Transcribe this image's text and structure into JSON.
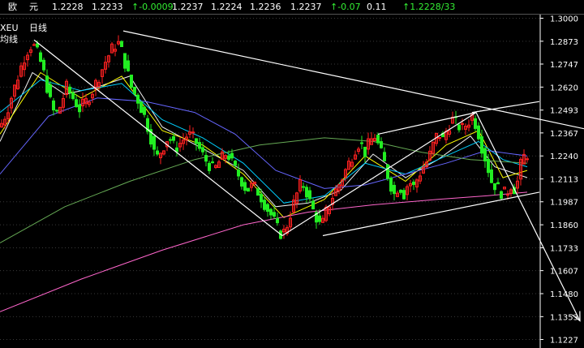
{
  "quote_bar": {
    "name_a": "欧",
    "name_b": "元",
    "fields": [
      {
        "text": "1.2228",
        "color": "white"
      },
      {
        "text": "1.2233",
        "color": "white"
      },
      {
        "text": "-0.0009",
        "color": "green",
        "arrow": "↑"
      },
      {
        "text": "1.2237",
        "color": "white"
      },
      {
        "text": "1.2224",
        "color": "white"
      },
      {
        "text": "1.2236",
        "color": "white"
      },
      {
        "text": "1.2237",
        "color": "white"
      },
      {
        "text": "-0.07",
        "color": "green",
        "arrow": "↑"
      },
      {
        "text": "0.11",
        "color": "white"
      },
      {
        "text": "1.2228/33",
        "color": "green",
        "arrow": "↑"
      }
    ]
  },
  "legend": {
    "symbol": "XEU",
    "period": "日线",
    "line2": "均线"
  },
  "colors": {
    "background": "#000000",
    "up_candle": "#ff2020",
    "down_candle": "#22ee22",
    "axis": "#ffffff",
    "grid": "#3a3a3a"
  },
  "chart_data": {
    "type": "candlestick",
    "y_axis_ticks": [
      "1.3000",
      "1.2873",
      "1.2747",
      "1.2620",
      "1.2493",
      "1.2367",
      "1.2240",
      "1.2113",
      "1.1987",
      "1.1860",
      "1.1733",
      "1.1607",
      "1.1480",
      "1.1353",
      "1.1227"
    ],
    "ylim": [
      1.118,
      1.302
    ],
    "price_path": [
      [
        0,
        1.24
      ],
      [
        8,
        1.248
      ],
      [
        18,
        1.262
      ],
      [
        25,
        1.272
      ],
      [
        32,
        1.281
      ],
      [
        40,
        1.286
      ],
      [
        48,
        1.279
      ],
      [
        55,
        1.268
      ],
      [
        62,
        1.254
      ],
      [
        68,
        1.246
      ],
      [
        75,
        1.252
      ],
      [
        82,
        1.262
      ],
      [
        90,
        1.256
      ],
      [
        98,
        1.25
      ],
      [
        106,
        1.254
      ],
      [
        114,
        1.26
      ],
      [
        122,
        1.268
      ],
      [
        130,
        1.276
      ],
      [
        138,
        1.283
      ],
      [
        145,
        1.287
      ],
      [
        150,
        1.282
      ],
      [
        156,
        1.272
      ],
      [
        162,
        1.262
      ],
      [
        170,
        1.255
      ],
      [
        178,
        1.246
      ],
      [
        185,
        1.236
      ],
      [
        192,
        1.222
      ],
      [
        200,
        1.228
      ],
      [
        208,
        1.235
      ],
      [
        216,
        1.228
      ],
      [
        224,
        1.232
      ],
      [
        232,
        1.236
      ],
      [
        240,
        1.233
      ],
      [
        248,
        1.226
      ],
      [
        256,
        1.22
      ],
      [
        264,
        1.216
      ],
      [
        272,
        1.222
      ],
      [
        280,
        1.226
      ],
      [
        288,
        1.218
      ],
      [
        296,
        1.212
      ],
      [
        304,
        1.205
      ],
      [
        312,
        1.208
      ],
      [
        320,
        1.203
      ],
      [
        328,
        1.196
      ],
      [
        336,
        1.19
      ],
      [
        342,
        1.184
      ],
      [
        348,
        1.18
      ],
      [
        354,
        1.186
      ],
      [
        360,
        1.195
      ],
      [
        366,
        1.203
      ],
      [
        372,
        1.21
      ],
      [
        378,
        1.204
      ],
      [
        384,
        1.196
      ],
      [
        390,
        1.19
      ],
      [
        396,
        1.184
      ],
      [
        402,
        1.193
      ],
      [
        408,
        1.2
      ],
      [
        414,
        1.205
      ],
      [
        420,
        1.21
      ],
      [
        426,
        1.216
      ],
      [
        432,
        1.222
      ],
      [
        438,
        1.228
      ],
      [
        444,
        1.232
      ],
      [
        450,
        1.226
      ],
      [
        456,
        1.232
      ],
      [
        462,
        1.235
      ],
      [
        468,
        1.228
      ],
      [
        474,
        1.22
      ],
      [
        480,
        1.21
      ],
      [
        486,
        1.203
      ],
      [
        492,
        1.208
      ],
      [
        498,
        1.203
      ],
      [
        504,
        1.21
      ],
      [
        510,
        1.207
      ],
      [
        516,
        1.213
      ],
      [
        522,
        1.218
      ],
      [
        528,
        1.222
      ],
      [
        534,
        1.23
      ],
      [
        540,
        1.237
      ],
      [
        546,
        1.233
      ],
      [
        552,
        1.24
      ],
      [
        558,
        1.244
      ],
      [
        564,
        1.241
      ],
      [
        570,
        1.239
      ],
      [
        576,
        1.242
      ],
      [
        582,
        1.246
      ],
      [
        588,
        1.24
      ],
      [
        594,
        1.229
      ],
      [
        600,
        1.22
      ],
      [
        606,
        1.21
      ],
      [
        612,
        1.207
      ],
      [
        618,
        1.204
      ],
      [
        624,
        1.203
      ],
      [
        630,
        1.208
      ],
      [
        636,
        1.205
      ],
      [
        642,
        1.219
      ],
      [
        648,
        1.226
      ],
      [
        652,
        1.224
      ]
    ],
    "moving_averages": [
      {
        "color": "#f0f0f0",
        "points": [
          [
            0,
            1.232
          ],
          [
            40,
            1.27
          ],
          [
            80,
            1.258
          ],
          [
            120,
            1.262
          ],
          [
            160,
            1.268
          ],
          [
            200,
            1.24
          ],
          [
            250,
            1.228
          ],
          [
            300,
            1.216
          ],
          [
            340,
            1.196
          ],
          [
            380,
            1.198
          ],
          [
            420,
            1.205
          ],
          [
            460,
            1.225
          ],
          [
            500,
            1.212
          ],
          [
            540,
            1.222
          ],
          [
            580,
            1.235
          ],
          [
            610,
            1.218
          ],
          [
            650,
            1.212
          ]
        ]
      },
      {
        "color": "#ffff00",
        "points": [
          [
            0,
            1.236
          ],
          [
            50,
            1.27
          ],
          [
            100,
            1.256
          ],
          [
            150,
            1.268
          ],
          [
            200,
            1.238
          ],
          [
            250,
            1.23
          ],
          [
            300,
            1.214
          ],
          [
            350,
            1.19
          ],
          [
            400,
            1.2
          ],
          [
            450,
            1.224
          ],
          [
            500,
            1.21
          ],
          [
            550,
            1.23
          ],
          [
            590,
            1.238
          ],
          [
            620,
            1.212
          ],
          [
            650,
            1.216
          ]
        ]
      },
      {
        "color": "#00d0ff",
        "points": [
          [
            0,
            1.248
          ],
          [
            50,
            1.266
          ],
          [
            100,
            1.26
          ],
          [
            150,
            1.264
          ],
          [
            200,
            1.244
          ],
          [
            250,
            1.234
          ],
          [
            300,
            1.22
          ],
          [
            350,
            1.198
          ],
          [
            400,
            1.202
          ],
          [
            450,
            1.22
          ],
          [
            500,
            1.214
          ],
          [
            550,
            1.224
          ],
          [
            590,
            1.232
          ],
          [
            620,
            1.222
          ],
          [
            650,
            1.218
          ]
        ]
      },
      {
        "color": "#6666ff",
        "points": [
          [
            0,
            1.214
          ],
          [
            60,
            1.246
          ],
          [
            120,
            1.256
          ],
          [
            180,
            1.254
          ],
          [
            240,
            1.248
          ],
          [
            290,
            1.236
          ],
          [
            340,
            1.216
          ],
          [
            400,
            1.206
          ],
          [
            450,
            1.208
          ],
          [
            500,
            1.214
          ],
          [
            550,
            1.22
          ],
          [
            600,
            1.227
          ],
          [
            650,
            1.224
          ]
        ]
      },
      {
        "color": "#66aa55",
        "points": [
          [
            0,
            1.176
          ],
          [
            80,
            1.196
          ],
          [
            160,
            1.21
          ],
          [
            240,
            1.222
          ],
          [
            320,
            1.23
          ],
          [
            400,
            1.234
          ],
          [
            460,
            1.232
          ],
          [
            520,
            1.226
          ],
          [
            580,
            1.222
          ],
          [
            650,
            1.22
          ]
        ]
      },
      {
        "color": "#ff66cc",
        "points": [
          [
            0,
            1.138
          ],
          [
            100,
            1.156
          ],
          [
            200,
            1.172
          ],
          [
            300,
            1.186
          ],
          [
            380,
            1.193
          ],
          [
            460,
            1.197
          ],
          [
            540,
            1.2
          ],
          [
            600,
            1.202
          ],
          [
            650,
            1.204
          ]
        ]
      }
    ],
    "trendlines": [
      {
        "from": [
          42,
          1.288
        ],
        "to": [
          348,
          1.18
        ],
        "arrow": false
      },
      {
        "from": [
          152,
          1.293
        ],
        "to": [
          720,
          1.239
        ],
        "arrow": false
      },
      {
        "from": [
          348,
          1.18
        ],
        "to": [
          587,
          1.248
        ],
        "arrow": false
      },
      {
        "from": [
          466,
          1.236
        ],
        "to": [
          587,
          1.248
        ],
        "arrow": false
      },
      {
        "from": [
          398,
          1.18
        ],
        "to": [
          665,
          1.204
        ],
        "arrow": false
      },
      {
        "from": [
          582,
          1.248
        ],
        "to": [
          665,
          1.254
        ],
        "arrow": false
      },
      {
        "from": [
          587,
          1.248
        ],
        "to": [
          715,
          1.133
        ],
        "arrow": true
      }
    ]
  }
}
